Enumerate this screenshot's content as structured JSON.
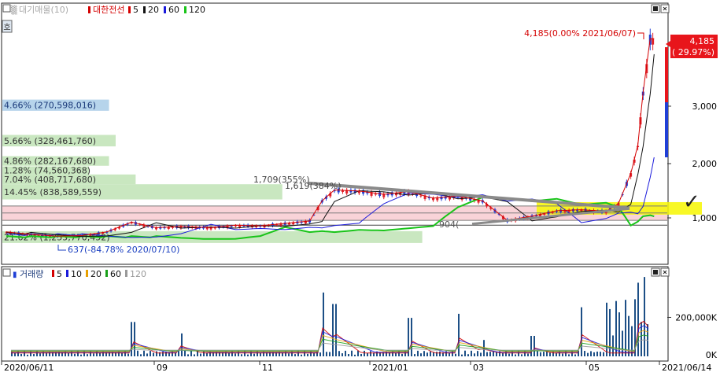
{
  "price_panel": {
    "legend": {
      "selector_icon": "square-icon",
      "vp_label": "대기매물(10)",
      "stock_label": "대한전선",
      "ma_items": [
        {
          "label": "5",
          "color": "#d40000"
        },
        {
          "label": "20",
          "color": "#111111"
        },
        {
          "label": "60",
          "color": "#1a1adb"
        },
        {
          "label": "120",
          "color": "#19c419"
        }
      ]
    },
    "badge_char": "호",
    "volume_profile": [
      {
        "text": "4.66% (270,598,016)",
        "band": [
          2920,
          3120
        ],
        "span": 0.16,
        "color": "#a9cde8"
      },
      {
        "text": "5.66% (328,461,760)",
        "band": [
          2300,
          2500
        ],
        "span": 0.17,
        "color": "#bfe3b5"
      },
      {
        "text": "4.86% (282,167,680)",
        "band": [
          1960,
          2130
        ],
        "span": 0.16,
        "color": "#bfe3b5"
      },
      {
        "text": "1.28% (74,560,368)",
        "band": [
          1800,
          1950
        ],
        "span": 0.13,
        "color": "#bfe3b5"
      },
      {
        "text": "7.04% (408,717,680)",
        "band": [
          1620,
          1800
        ],
        "span": 0.2,
        "color": "#bfe3b5"
      },
      {
        "text": "14.45% (838,589,559)",
        "band": [
          1340,
          1620
        ],
        "span": 0.42,
        "color": "#bfe3b5"
      },
      {
        "text": "21.62% (1,255,770,452)",
        "band": [
          560,
          780
        ],
        "span": 0.63,
        "color": "#bfe3b5"
      }
    ],
    "current_price_label": {
      "price": "4,185",
      "change": "( 29.97%)"
    },
    "high_label": "4,185(0.00% 2021/06/07)",
    "low_label": "637(-84.78% 2020/07/10)",
    "peak_label": "1,709(355%)",
    "peak2_label": "1,619(384%)",
    "trough_label": "904(",
    "checkmark": "✓",
    "y_ticks": [
      "1,000",
      "2,000",
      "3,000"
    ]
  },
  "volume_panel": {
    "legend": {
      "selector_icon": "square-icon",
      "label": "거래량",
      "ma_items": [
        {
          "label": "5",
          "color": "#d40000"
        },
        {
          "label": "10",
          "color": "#1a1adb"
        },
        {
          "label": "20",
          "color": "#e8a000"
        },
        {
          "label": "60",
          "color": "#19a019"
        },
        {
          "label": "120",
          "color": "#999999"
        }
      ]
    },
    "y_ticks": [
      "0K",
      "200,000K"
    ]
  },
  "x_ticks": [
    "2020/06/11",
    "09",
    "11",
    "2021/01",
    "03",
    "05",
    "2021/06/14"
  ],
  "chart_data": {
    "type": "candlestick",
    "x": [
      "2020/06/11",
      "2020/06/25",
      "2020/07/10",
      "2020/07/24",
      "2020/08/07",
      "2020/08/21",
      "2020/09/04",
      "2020/09/18",
      "2020/10/05",
      "2020/10/19",
      "2020/11/02",
      "2020/11/16",
      "2020/11/30",
      "2020/12/07",
      "2020/12/14",
      "2020/12/28",
      "2021/01/11",
      "2021/01/25",
      "2021/02/08",
      "2021/02/22",
      "2021/03/08",
      "2021/03/22",
      "2021/04/05",
      "2021/04/19",
      "2021/05/03",
      "2021/05/17",
      "2021/05/24",
      "2021/05/31",
      "2021/06/04",
      "2021/06/07",
      "2021/06/11",
      "2021/06/14"
    ],
    "close": [
      760,
      720,
      690,
      700,
      760,
      920,
      830,
      850,
      830,
      870,
      860,
      900,
      940,
      1300,
      1500,
      1480,
      1420,
      1470,
      1350,
      1390,
      1300,
      950,
      1020,
      1120,
      1140,
      1110,
      1250,
      1800,
      2300,
      3220,
      4185,
      4185
    ],
    "ylim": [
      0,
      4500
    ],
    "volume_ylim": [
      0,
      420000
    ],
    "volume_unit": "K"
  }
}
